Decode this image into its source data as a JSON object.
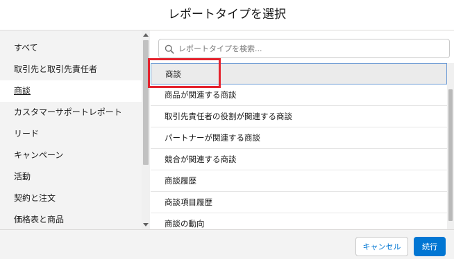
{
  "dialog": {
    "title": "レポートタイプを選択"
  },
  "sidebar": {
    "items": [
      {
        "label": "すべて"
      },
      {
        "label": "取引先と取引先責任者"
      },
      {
        "label": "商談"
      },
      {
        "label": "カスタマーサポートレポート"
      },
      {
        "label": "リード"
      },
      {
        "label": "キャンペーン"
      },
      {
        "label": "活動"
      },
      {
        "label": "契約と注文"
      },
      {
        "label": "価格表と商品"
      }
    ],
    "active_index": 2
  },
  "search": {
    "placeholder": "レポートタイプを検索..."
  },
  "report_types": {
    "items": [
      {
        "label": "商談"
      },
      {
        "label": "商品が関連する商談"
      },
      {
        "label": "取引先責任者の役割が関連する商談"
      },
      {
        "label": "パートナーが関連する商談"
      },
      {
        "label": "競合が関連する商談"
      },
      {
        "label": "商談履歴"
      },
      {
        "label": "商談項目履歴"
      },
      {
        "label": "商談の動向"
      }
    ],
    "selected_index": 0
  },
  "footer": {
    "cancel_label": "キャンセル",
    "next_label": "続行"
  },
  "colors": {
    "brand_blue": "#0176d3",
    "highlight_red": "#e4222d",
    "sidebar_bg": "#f3f3f3"
  },
  "icons": {
    "search": "search-icon",
    "scroll_up": "chevron-up-icon",
    "scroll_down": "chevron-down-icon"
  }
}
